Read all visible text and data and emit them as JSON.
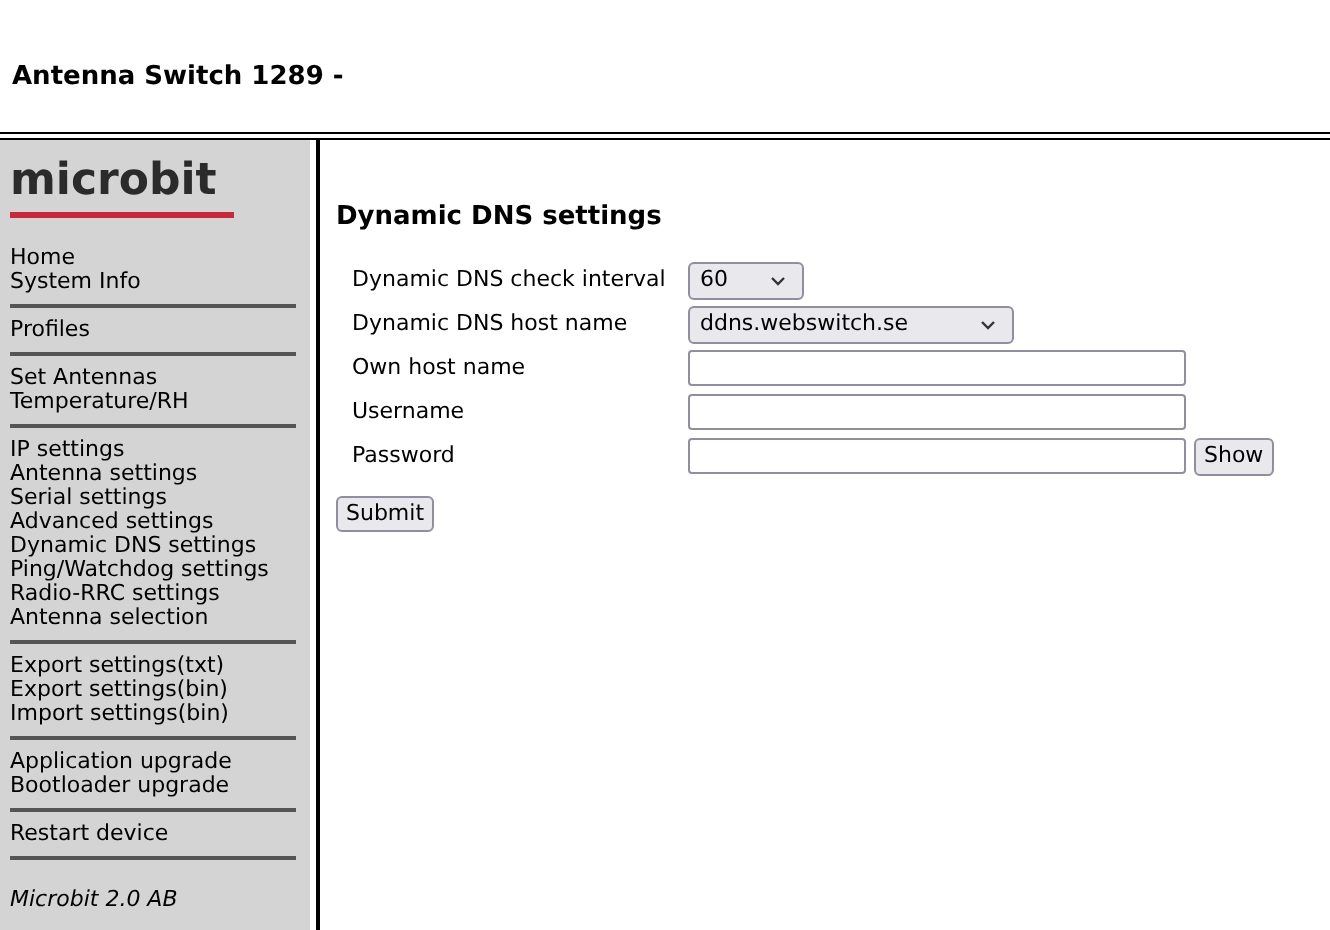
{
  "header": {
    "title": "Antenna Switch 1289 -"
  },
  "sidebar": {
    "logo": "microbit",
    "groups": [
      {
        "items": [
          "Home",
          "System Info"
        ]
      },
      {
        "items": [
          "Profiles"
        ]
      },
      {
        "items": [
          "Set Antennas",
          "Temperature/RH"
        ]
      },
      {
        "items": [
          "IP settings",
          "Antenna settings",
          "Serial settings",
          "Advanced settings",
          "Dynamic DNS settings",
          "Ping/Watchdog settings",
          "Radio-RRC settings",
          "Antenna selection"
        ]
      },
      {
        "items": [
          "Export settings(txt)",
          "Export settings(bin)",
          "Import settings(bin)"
        ]
      },
      {
        "items": [
          "Application upgrade",
          "Bootloader upgrade"
        ]
      },
      {
        "items": [
          "Restart device"
        ]
      }
    ],
    "footer": "Microbit 2.0 AB"
  },
  "form": {
    "title": "Dynamic DNS settings",
    "fields": [
      {
        "label": "Dynamic DNS check interval",
        "kind": "select",
        "value": "60"
      },
      {
        "label": "Dynamic DNS host name",
        "kind": "select",
        "value": "ddns.webswitch.se"
      },
      {
        "label": "Own host name",
        "kind": "text"
      },
      {
        "label": "Username",
        "kind": "text"
      },
      {
        "label": "Password",
        "kind": "password",
        "button": "Show"
      }
    ],
    "submit": "Submit"
  }
}
